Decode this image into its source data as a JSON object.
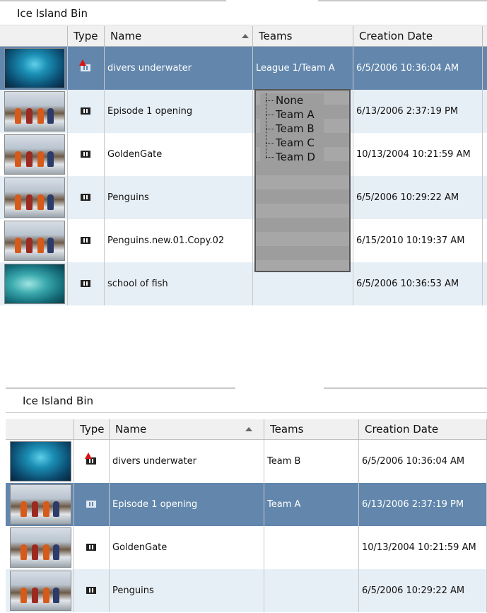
{
  "top": {
    "bin_title": "Ice Island Bin",
    "columns": {
      "type": "Type",
      "name": "Name",
      "teams": "Teams",
      "date": "Creation Date"
    },
    "rows": [
      {
        "thumb": "water",
        "icon": "sequence-flag-icon",
        "name": "divers underwater",
        "teams": "League 1/Team A",
        "date": "6/5/2006 10:36:04 AM",
        "style": "sel"
      },
      {
        "thumb": "crew",
        "icon": "sequence-icon",
        "name": "Episode 1 opening",
        "teams": "",
        "date": "6/13/2006 2:37:19 PM",
        "style": "light"
      },
      {
        "thumb": "crew",
        "icon": "clip-icon",
        "name": "GoldenGate",
        "teams": "",
        "date": "10/13/2004 10:21:59 AM",
        "style": "white"
      },
      {
        "thumb": "crew",
        "icon": "clip-icon",
        "name": "Penguins",
        "teams": "",
        "date": "6/5/2006 10:29:22 AM",
        "style": "light"
      },
      {
        "thumb": "crew",
        "icon": "clip-icon",
        "name": "Penguins.new.01.Copy.02",
        "teams": "",
        "date": "6/15/2010 10:19:37 AM",
        "style": "white"
      },
      {
        "thumb": "fish",
        "icon": "clip-icon",
        "name": "school of fish",
        "teams": "",
        "date": "6/5/2006 10:36:53 AM",
        "style": "light"
      }
    ],
    "team_dropdown": [
      "None",
      "Team A",
      "Team B",
      "Team C",
      "Team D"
    ]
  },
  "bottom": {
    "bin_title": "Ice Island Bin",
    "columns": {
      "type": "Type",
      "name": "Name",
      "teams": "Teams",
      "date": "Creation Date"
    },
    "rows": [
      {
        "thumb": "water",
        "icon": "sequence-flag-icon",
        "name": "divers underwater",
        "teams": "Team B",
        "date": "6/5/2006 10:36:04 AM",
        "style": "white"
      },
      {
        "thumb": "crew",
        "icon": "sequence-icon",
        "name": "Episode 1 opening",
        "teams": "Team A",
        "date": "6/13/2006 2:37:19 PM",
        "style": "sel"
      },
      {
        "thumb": "crew",
        "icon": "clip-icon",
        "name": "GoldenGate",
        "teams": "",
        "date": "10/13/2004 10:21:59 AM",
        "style": "white"
      },
      {
        "thumb": "crew",
        "icon": "clip-icon",
        "name": "Penguins",
        "teams": "",
        "date": "6/5/2006 10:29:22 AM",
        "style": "light"
      }
    ]
  },
  "colors": {
    "selection": "#6286ac",
    "row_alt": "#e7eff6",
    "dropdown": "#a7a7a7"
  }
}
